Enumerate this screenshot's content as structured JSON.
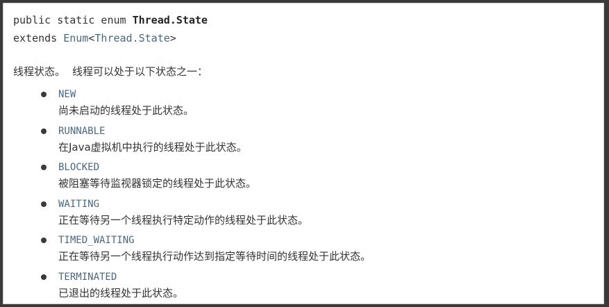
{
  "signature": {
    "line1_prefix": "public static enum ",
    "line1_name": "Thread.State",
    "line2_prefix": "extends ",
    "line2_enum": "Enum",
    "line2_lt": "<",
    "line2_type": "Thread.State",
    "line2_gt": ">"
  },
  "description": {
    "part1": "线程状态。",
    "part2": "线程可以处于以下状态之一："
  },
  "states": [
    {
      "name": "NEW",
      "desc": "尚未启动的线程处于此状态。"
    },
    {
      "name": "RUNNABLE",
      "desc": "在Java虚拟机中执行的线程处于此状态。"
    },
    {
      "name": "BLOCKED",
      "desc": "被阻塞等待监视器锁定的线程处于此状态。"
    },
    {
      "name": "WAITING",
      "desc": "正在等待另一个线程执行特定动作的线程处于此状态。"
    },
    {
      "name": "TIMED_WAITING",
      "desc": "正在等待另一个线程执行动作达到指定等待时间的线程处于此状态。"
    },
    {
      "name": "TERMINATED",
      "desc": "已退出的线程处于此状态。"
    }
  ],
  "colors": {
    "link": "#4a6782",
    "text": "#333333",
    "background": "#ffffff"
  }
}
